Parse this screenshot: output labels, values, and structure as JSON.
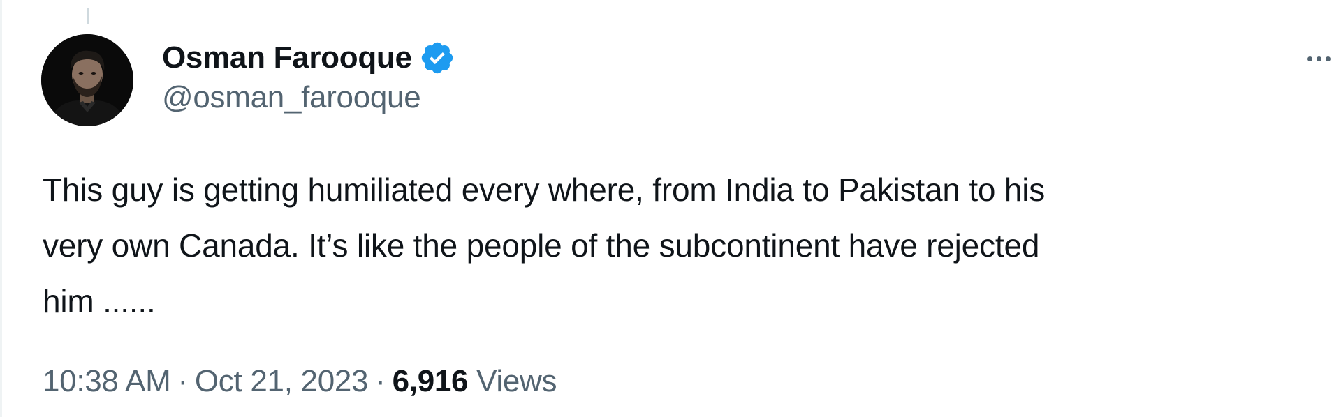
{
  "author": {
    "display_name": "Osman Farooque",
    "handle": "@osman_farooque",
    "verified_icon": "verified-badge-icon"
  },
  "tweet": {
    "text_lines": [
      "This guy is getting humiliated every where, from India to Pakistan to his",
      "very own Canada. It’s like the people of the subcontinent have rejected",
      "him ......"
    ],
    "time": "10:38 AM",
    "separator": "·",
    "date": "Oct 21, 2023",
    "views_count": "6,916",
    "views_label": "Views"
  },
  "colors": {
    "text_primary": "#0f1419",
    "text_secondary": "#536471",
    "verified_blue": "#1d9bf0"
  },
  "icons": {
    "more": "more-options-icon"
  }
}
